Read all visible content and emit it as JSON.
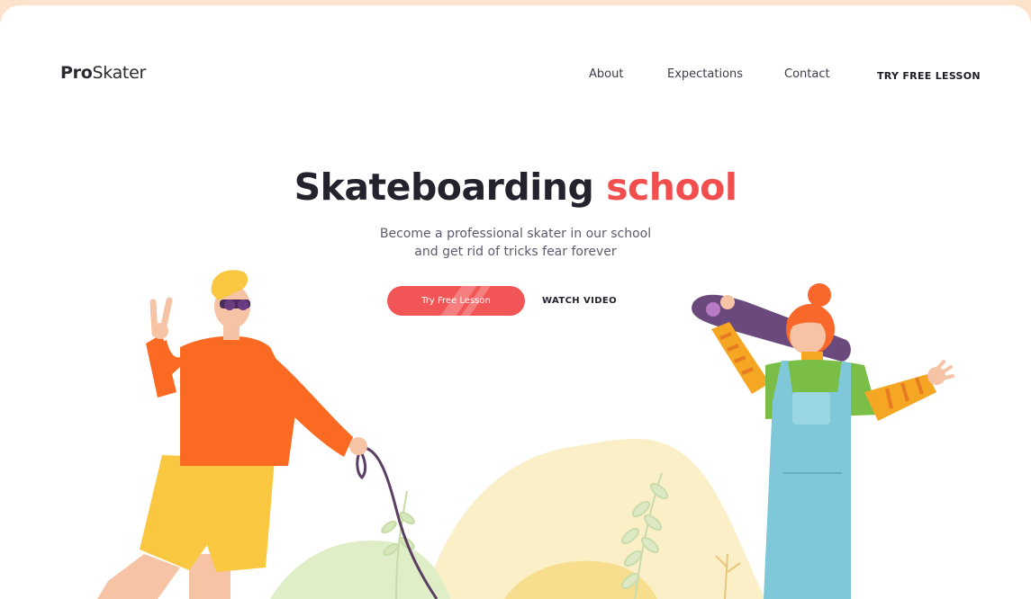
{
  "brand": {
    "bold": "Pro",
    "light": "Skater"
  },
  "nav": {
    "about": "About",
    "expectations": "Expectations",
    "contact": "Contact",
    "cta": "TRY FREE LESSON"
  },
  "hero": {
    "title_main": "Skateboarding",
    "title_accent": "school",
    "subtitle_line1": "Become a professional skater in our school",
    "subtitle_line2": "and get rid of tricks fear forever",
    "primary_button": "Try Free Lesson",
    "secondary_button": "WATCH VIDEO"
  },
  "colors": {
    "page_background": "#fde3cc",
    "accent": "#f24e4e",
    "text_dark": "#23232e"
  },
  "illustrations": [
    "boy-with-sunglasses",
    "girl-with-skateboard",
    "hills",
    "plants"
  ]
}
